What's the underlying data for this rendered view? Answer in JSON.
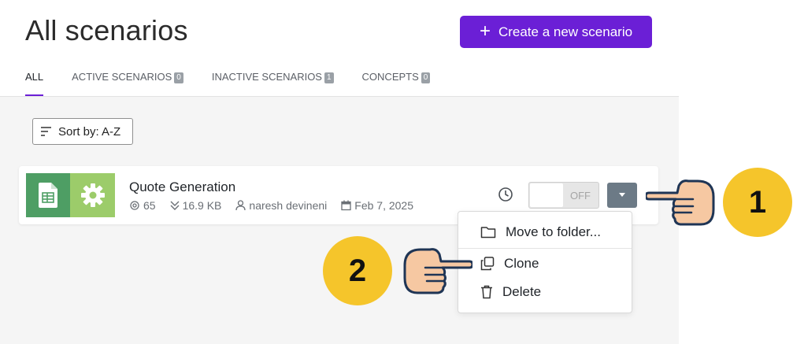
{
  "header": {
    "title": "All scenarios",
    "create_label": "Create a new scenario"
  },
  "tabs": [
    {
      "label": "ALL",
      "count": null,
      "active": true
    },
    {
      "label": "ACTIVE SCENARIOS",
      "count": "0"
    },
    {
      "label": "INACTIVE SCENARIOS",
      "count": "1"
    },
    {
      "label": "CONCEPTS",
      "count": "0"
    }
  ],
  "sort": {
    "label": "Sort by: A-Z"
  },
  "scenario": {
    "name": "Quote Generation",
    "operations": "65",
    "data_transfer": "16.9 KB",
    "owner": "naresh devineni",
    "date": "Feb 7, 2025",
    "toggle_label": "OFF"
  },
  "menu": {
    "items": [
      {
        "label": "Move to folder...",
        "icon": "folder-icon"
      },
      {
        "label": "Clone",
        "icon": "copy-icon"
      },
      {
        "label": "Delete",
        "icon": "trash-icon"
      }
    ]
  },
  "annotations": {
    "step1": "1",
    "step2": "2"
  },
  "colors": {
    "accent": "#6b1fd6",
    "step_yellow": "#f5c52b",
    "sheets_green": "#4e9e64",
    "tools_green": "#9ccc6a"
  }
}
